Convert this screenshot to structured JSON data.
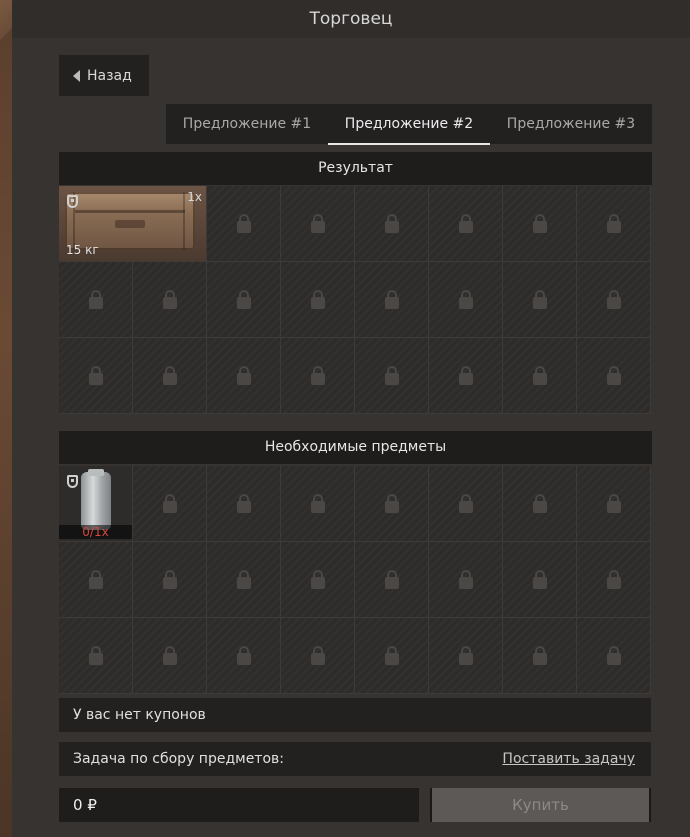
{
  "window": {
    "title": "Торговец"
  },
  "nav": {
    "back_label": "Назад"
  },
  "tabs": [
    {
      "label": "Предложение #1",
      "active": false
    },
    {
      "label": "Предложение #2",
      "active": true
    },
    {
      "label": "Предложение #3",
      "active": false
    }
  ],
  "result": {
    "header": "Результат",
    "item": {
      "icon": "ammo-crate",
      "count": "1x",
      "weight": "15 кг"
    }
  },
  "required": {
    "header": "Необходимые предметы",
    "item": {
      "icon": "glass-jar",
      "count": "0/1x"
    }
  },
  "coupons": {
    "text": "У вас нет купонов"
  },
  "task": {
    "label": "Задача по сбору предметов:",
    "link": "Поставить задачу"
  },
  "price": {
    "value": "0",
    "currency": "₽"
  },
  "buy": {
    "label": "Купить",
    "enabled": false
  },
  "colors": {
    "required_count": "#d6453a",
    "active_tab_underline": "#e6e6e6"
  }
}
